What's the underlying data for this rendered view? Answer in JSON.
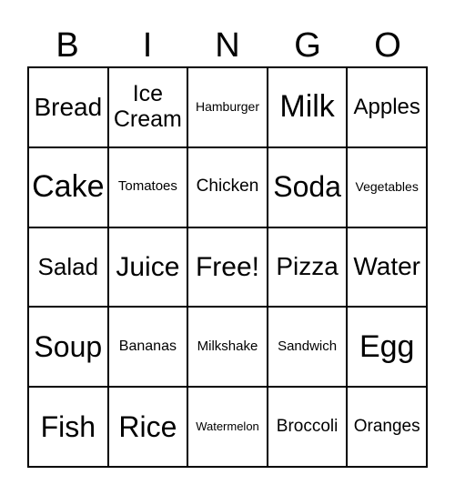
{
  "header": [
    "B",
    "I",
    "N",
    "G",
    "O"
  ],
  "cells": [
    [
      "Bread",
      "Ice Cream",
      "Hamburger",
      "Milk",
      "Apples"
    ],
    [
      "Cake",
      "Tomatoes",
      "Chicken",
      "Soda",
      "Vegetables"
    ],
    [
      "Salad",
      "Juice",
      "Free!",
      "Pizza",
      "Water"
    ],
    [
      "Soup",
      "Bananas",
      "Milkshake",
      "Sandwich",
      "Egg"
    ],
    [
      "Fish",
      "Rice",
      "Watermelon",
      "Broccoli",
      "Oranges"
    ]
  ]
}
